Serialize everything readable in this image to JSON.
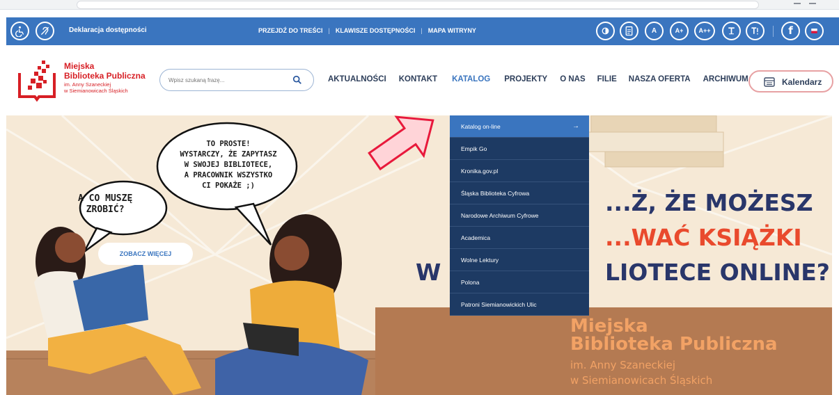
{
  "topbar": {
    "declaration": "Deklaracja dostępności",
    "skiplinks": [
      "PRZEJDŹ DO TREŚCI",
      "KLAWISZE DOSTĘPNOŚCI",
      "MAPA WITRYNY"
    ],
    "font_buttons": [
      "A",
      "A+",
      "A++"
    ],
    "facebook": "f"
  },
  "logo": {
    "line1": "Miejska",
    "line2": "Biblioteka Publiczna",
    "line3": "im. Anny Szaneckiej",
    "line4": "w Siemianowicach Śląskich"
  },
  "search": {
    "placeholder": "Wpisz szukaną frazę..."
  },
  "nav": {
    "items": [
      "AKTUALNOŚCI",
      "KONTAKT",
      "KATALOG",
      "PROJEKTY",
      "O NAS",
      "FILIE",
      "NASZA OFERTA",
      "ARCHIWUM"
    ],
    "active": "KATALOG",
    "calendar": "Kalendarz"
  },
  "dropdown": {
    "items": [
      "Katalog on-line",
      "Empik Go",
      "Kronika.gov.pl",
      "Śląska Biblioteka Cyfrowa",
      "Narodowe Archiwum Cyfrowe",
      "Academica",
      "Wolne Lektury",
      "Polona",
      "Patroni Siemianowickich Ulic"
    ],
    "active_arrow": "→"
  },
  "hero": {
    "bubble_big": [
      "TO PROSTE!",
      "WYSTARCZY, ŻE ZAPYTASZ",
      "W SWOJEJ BIBLIOTECE,",
      "A PRACOWNIK WSZYSTKO",
      "CI POKAŻE ;)"
    ],
    "bubble_small": [
      "A CO MUSZĘ",
      "ZROBIĆ?"
    ],
    "button": "ZOBACZ WIĘCEJ",
    "headline_1": "...Ż, ŻE MOŻESZ",
    "headline_2": "...WAĆ KSIĄŻKI",
    "headline_3a": "W S",
    "headline_3b": "LIOTECE ONLINE?",
    "logo_line1": "Miejska",
    "logo_line2": "Biblioteka Publiczna",
    "logo_line3": "im. Anny Szaneckiej",
    "logo_line4": "w Siemianowicach Śląskich"
  },
  "colors": {
    "brand_blue": "#3a75bf",
    "navy": "#1d3a63",
    "brand_red": "#d71f25"
  }
}
